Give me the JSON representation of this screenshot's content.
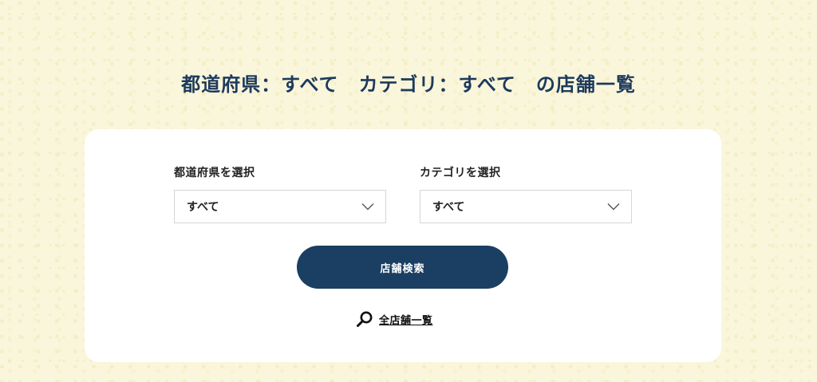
{
  "page_title": "都道府県：すべて　カテゴリ：すべて　の店舗一覧",
  "prefecture_field": {
    "label": "都道府県を選択",
    "selected": "すべて"
  },
  "category_field": {
    "label": "カテゴリを選択",
    "selected": "すべて"
  },
  "search_button_label": "店舗検索",
  "all_stores_link": {
    "label": "全店舗一覧",
    "icon": "search-icon"
  },
  "colors": {
    "title": "#1d3a5c",
    "button_bg": "#1b3f62",
    "background": "#faf6dc"
  }
}
